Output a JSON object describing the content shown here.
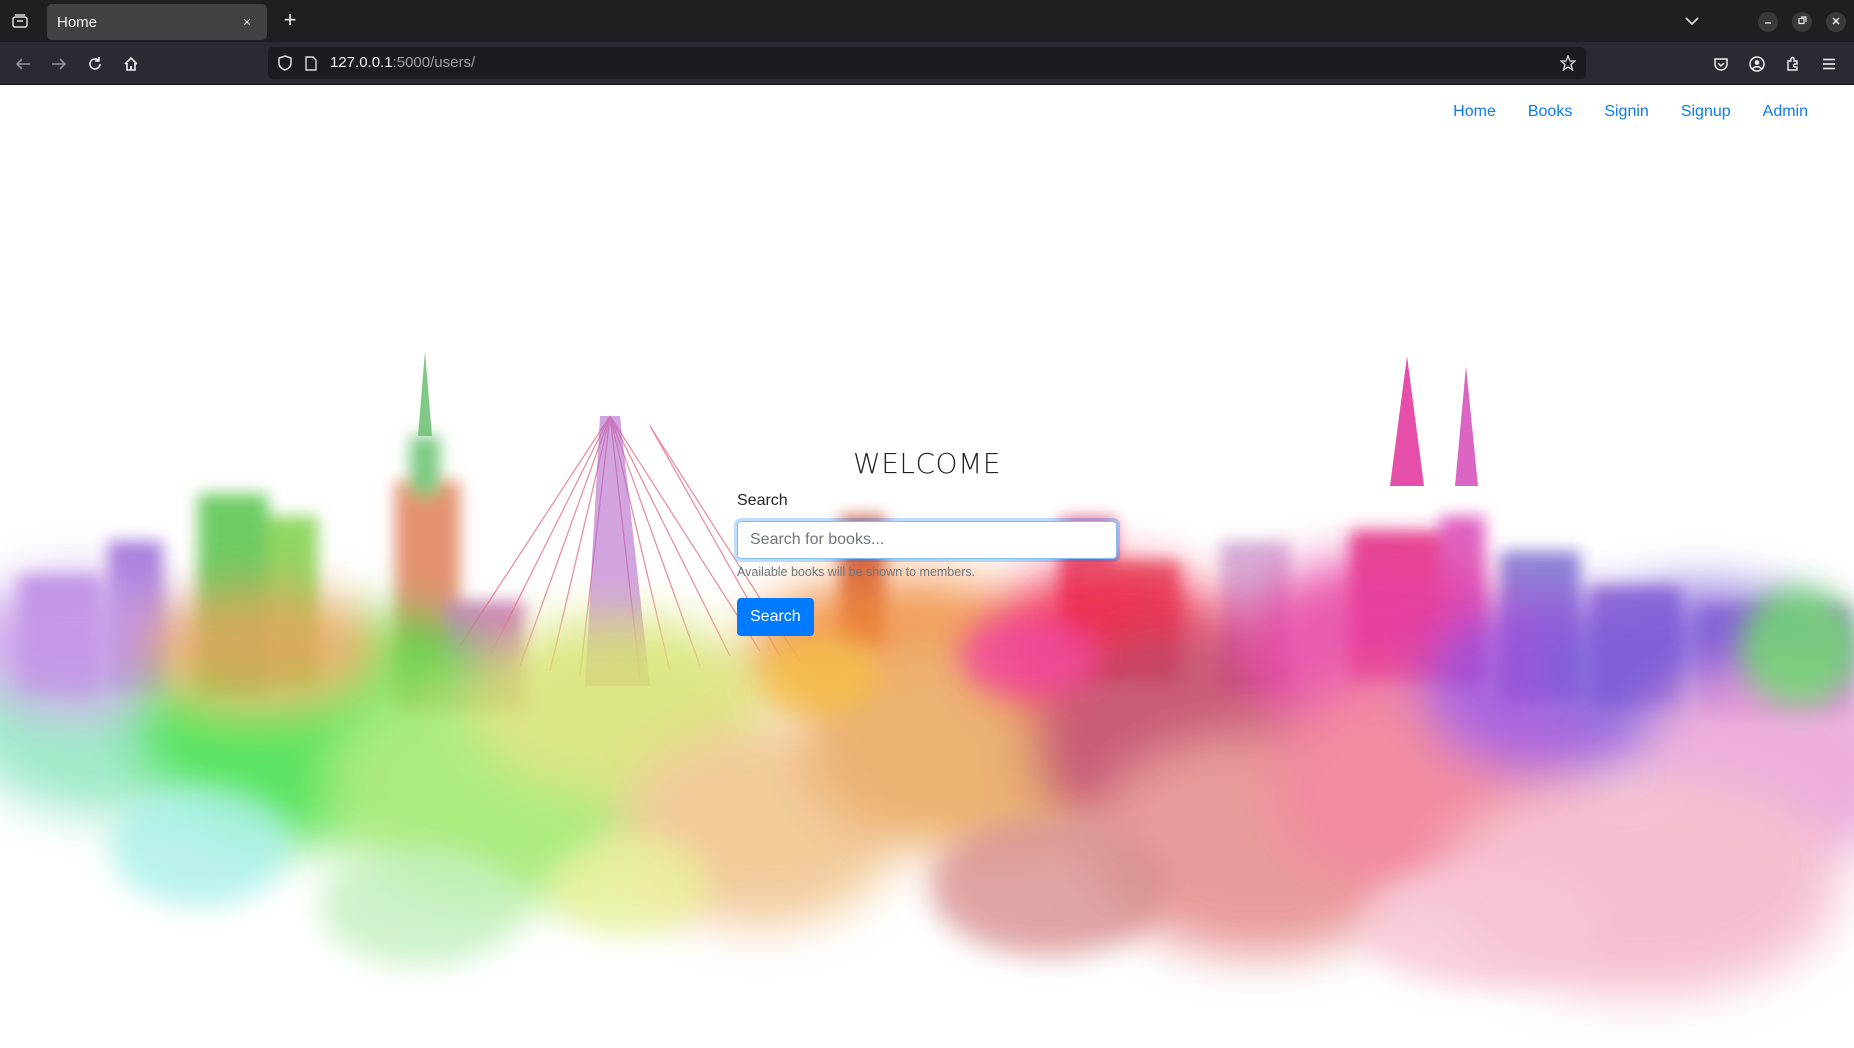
{
  "browser": {
    "tab_title": "Home",
    "tab_close": "×",
    "new_tab": "+",
    "url_host": "127.0.0.1",
    "url_rest": ":5000/users/"
  },
  "site": {
    "nav": [
      "Home",
      "Books",
      "Signin",
      "Signup",
      "Admin"
    ],
    "welcome": "WELCOME",
    "search_label": "Search",
    "search_placeholder": "Search for books...",
    "help_text": "Available books will be shown to members.",
    "search_button": "Search"
  },
  "colors": {
    "link": "#0d7bf2",
    "button": "#007bff"
  }
}
